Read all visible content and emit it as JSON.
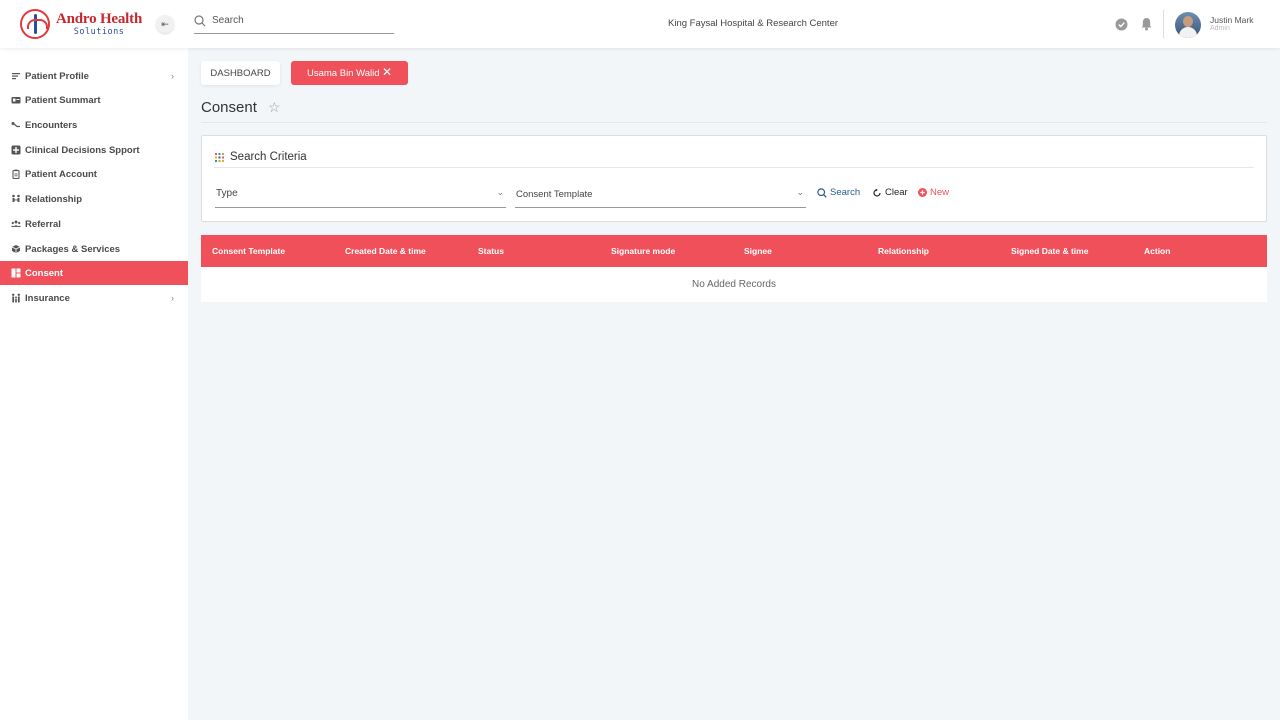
{
  "brand": {
    "title": "Andro Health",
    "subtitle": "Solutions"
  },
  "header": {
    "search_placeholder": "Search",
    "hospital": "King Faysal Hospital & Research Center",
    "user": {
      "name": "Justin Mark",
      "role": "Admin"
    }
  },
  "sidebar": {
    "items": [
      {
        "label": "Patient Profile",
        "icon": "list-icon",
        "chevron": "›"
      },
      {
        "label": "Patient Summart",
        "icon": "id-card-icon"
      },
      {
        "label": "Encounters",
        "icon": "route-icon"
      },
      {
        "label": "Clinical Decisions Spport",
        "icon": "medical-plus-icon"
      },
      {
        "label": "Patient Account",
        "icon": "clipboard-icon"
      },
      {
        "label": "Relationship",
        "icon": "people-link-icon"
      },
      {
        "label": "Referral",
        "icon": "group-icon"
      },
      {
        "label": "Packages & Services",
        "icon": "box-icon"
      },
      {
        "label": "Consent",
        "icon": "grid-icon",
        "active": true
      },
      {
        "label": "Insurance",
        "icon": "family-icon",
        "chevron": "›"
      }
    ]
  },
  "tabs": {
    "dashboard": "DASHBOARD",
    "patient": "Usama Bin Walid"
  },
  "page": {
    "title": "Consent"
  },
  "criteria": {
    "title": "Search Criteria",
    "type_label": "Type",
    "template_label": "Consent Template",
    "search": "Search",
    "clear": "Clear",
    "new": "New"
  },
  "table": {
    "headers": [
      "Consent Template",
      "Created Date & time",
      "Status",
      "Signature mode",
      "Signee",
      "Relationship",
      "Signed Date & time",
      "Action"
    ],
    "empty": "No Added Records"
  },
  "colors": {
    "accent": "#f0505a",
    "link": "#2a5b8c"
  }
}
